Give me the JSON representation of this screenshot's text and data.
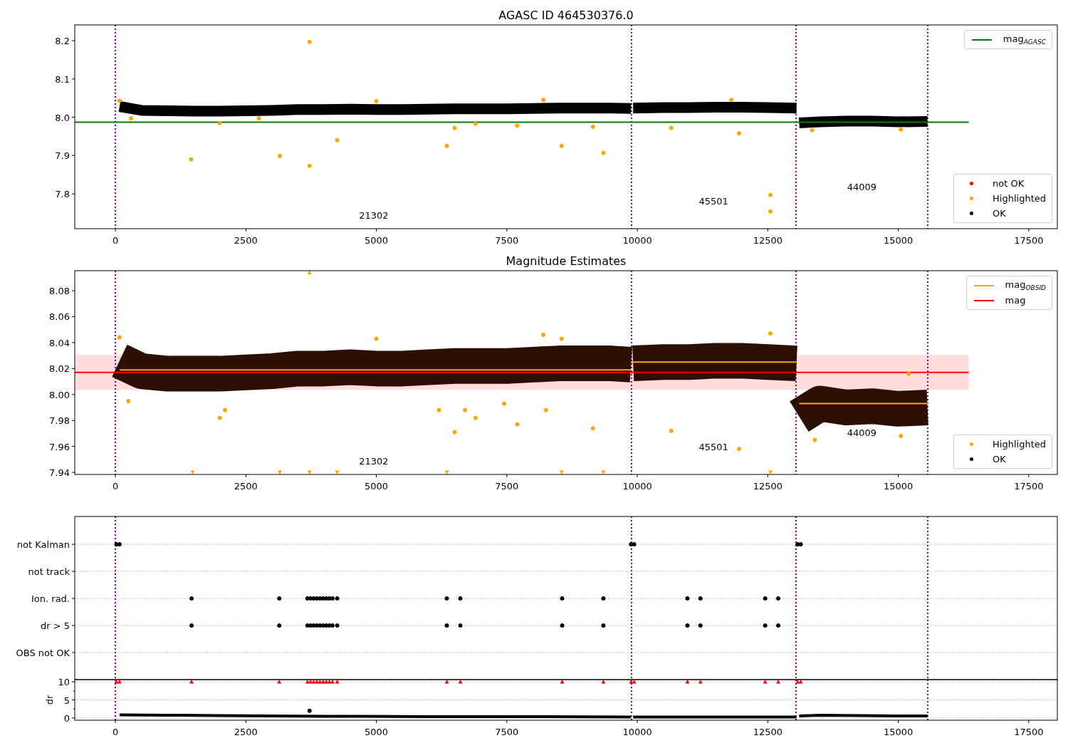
{
  "panels": [
    {
      "title": "AGASC ID 464530376.0",
      "charts": [
        {
          "chart_data": {
            "type": "scatter",
            "xlim": [
              -778,
              18047
            ],
            "ylim": [
              7.709,
              8.241
            ],
            "xticks": [
              0,
              2500,
              5000,
              7500,
              10000,
              12500,
              15000,
              17500
            ],
            "yticks": [
              {
                "value": 7.8,
                "label": "7.8"
              },
              {
                "value": 7.9,
                "label": "7.9"
              },
              {
                "value": 8.0,
                "label": "8.0"
              },
              {
                "value": 8.1,
                "label": "8.1"
              },
              {
                "value": 8.2,
                "label": "8.2"
              }
            ],
            "series": [
              {
                "type": "line",
                "marker": "none",
                "color": "#000000",
                "x": [
                  80,
                  500,
                  1000,
                  1500,
                  2000,
                  2500,
                  3000,
                  3500,
                  4000,
                  4500,
                  5000,
                  5500,
                  6000,
                  6500,
                  7000,
                  7500,
                  8000,
                  8500,
                  9000,
                  9500,
                  9880,
                  9900,
                  9920,
                  10500,
                  11000,
                  11500,
                  12000,
                  12500,
                  13050,
                  13075,
                  13100,
                  13500,
                  14000,
                  14500,
                  15000,
                  15560
                ],
                "values": [
                  8.028,
                  8.018,
                  8.017,
                  8.016,
                  8.016,
                  8.017,
                  8.018,
                  8.02,
                  8.02,
                  8.021,
                  8.02,
                  8.02,
                  8.021,
                  8.022,
                  8.022,
                  8.022,
                  8.023,
                  8.024,
                  8.024,
                  8.024,
                  8.023,
                  null,
                  8.024,
                  8.025,
                  8.025,
                  8.026,
                  8.026,
                  8.025,
                  8.024,
                  null,
                  7.985,
                  7.988,
                  7.99,
                  7.99,
                  7.988,
                  7.989
                ]
              },
              {
                "type": "scatter",
                "marker": "circle",
                "color": "#ffa500",
                "x": [
                  80,
                  300,
                  1450,
                  2000,
                  2750,
                  3150,
                  3720,
                  3720,
                  4250,
                  5000,
                  6350,
                  6500,
                  6900,
                  7700,
                  8200,
                  8550,
                  9150,
                  9350,
                  10650,
                  11800,
                  11950,
                  12550,
                  12550,
                  13350,
                  15050
                ],
                "values": [
                  8.043,
                  7.997,
                  7.89,
                  7.985,
                  7.997,
                  7.899,
                  7.873,
                  8.197,
                  7.94,
                  8.042,
                  7.925,
                  7.972,
                  7.983,
                  7.978,
                  8.045,
                  7.925,
                  7.975,
                  7.907,
                  7.972,
                  8.045,
                  7.958,
                  7.797,
                  7.754,
                  7.966,
                  7.968
                ]
              },
              {
                "type": "line",
                "marker": "none",
                "color": "#008000",
                "x": [
                  -778,
                  16350
                ],
                "values": [
                  7.987,
                  7.987
                ]
              }
            ],
            "ref_lines": [
              {
                "axis": "x",
                "value": 0,
                "color": "#800080"
              },
              {
                "axis": "x",
                "value": 9890,
                "color": "#800080"
              },
              {
                "axis": "x",
                "value": 13040,
                "color": "#800080"
              },
              {
                "axis": "x",
                "value": 15565,
                "color": "#800080"
              }
            ],
            "annotations": [
              "21302",
              "45501",
              "44009"
            ]
          },
          "legends": [
            {
              "entries": [
                {
                  "label": "mag$_{AGASC}$",
                  "kind": "line",
                  "color": "#008000"
                }
              ]
            },
            {
              "entries": [
                {
                  "label": "not OK",
                  "kind": "dot",
                  "color": "#ff0000"
                },
                {
                  "label": "Highlighted",
                  "kind": "dot",
                  "color": "#ffa500"
                },
                {
                  "label": "OK",
                  "kind": "dot",
                  "color": "#000000"
                }
              ]
            }
          ]
        }
      ]
    },
    {
      "title": "Magnitude Estimates",
      "charts": [
        {
          "chart_data": {
            "type": "scatter",
            "xlim": [
              -778,
              18047
            ],
            "ylim": [
              7.9384,
              8.0954
            ],
            "xticks": [
              0,
              2500,
              5000,
              7500,
              10000,
              12500,
              15000,
              17500
            ],
            "yticks": [
              {
                "value": 7.94,
                "label": "7.94"
              },
              {
                "value": 7.96,
                "label": "7.96"
              },
              {
                "value": 7.98,
                "label": "7.98"
              },
              {
                "value": 8.0,
                "label": "8.00"
              },
              {
                "value": 8.02,
                "label": "8.02"
              },
              {
                "value": 8.04,
                "label": "8.04"
              },
              {
                "value": 8.06,
                "label": "8.06"
              },
              {
                "value": 8.08,
                "label": "8.08"
              }
            ],
            "series": [
              {
                "type": "line",
                "marker": "none",
                "color": "#2b1000",
                "x": [
                  80,
                  500,
                  1000,
                  1500,
                  2000,
                  2500,
                  3000,
                  3500,
                  4000,
                  4500,
                  5000,
                  5500,
                  6000,
                  6500,
                  7000,
                  7500,
                  8000,
                  8500,
                  9000,
                  9500,
                  9880,
                  9900,
                  9920,
                  10500,
                  11000,
                  11500,
                  12000,
                  12500,
                  13050,
                  13075,
                  13100,
                  13500,
                  14000,
                  14500,
                  15000,
                  15560
                ],
                "values": [
                  8.026,
                  8.018,
                  8.016,
                  8.016,
                  8.016,
                  8.017,
                  8.018,
                  8.02,
                  8.02,
                  8.021,
                  8.02,
                  8.02,
                  8.021,
                  8.022,
                  8.022,
                  8.022,
                  8.023,
                  8.024,
                  8.024,
                  8.024,
                  8.023,
                  null,
                  8.024,
                  8.025,
                  8.025,
                  8.026,
                  8.026,
                  8.025,
                  8.024,
                  null,
                  7.983,
                  7.993,
                  7.99,
                  7.991,
                  7.989,
                  7.99
                ]
              },
              {
                "type": "scatter",
                "marker": "circle",
                "color": "#ffa500",
                "x": [
                  80,
                  250,
                  2000,
                  2100,
                  5000,
                  6200,
                  6500,
                  6700,
                  6900,
                  7450,
                  7700,
                  8200,
                  8250,
                  8550,
                  9150,
                  10650,
                  11950,
                  12550,
                  13400,
                  15050,
                  15200
                ],
                "values": [
                  8.044,
                  7.995,
                  7.982,
                  7.988,
                  8.043,
                  7.988,
                  7.971,
                  7.988,
                  7.982,
                  7.993,
                  7.977,
                  8.046,
                  7.988,
                  8.043,
                  7.974,
                  7.972,
                  7.958,
                  8.047,
                  7.965,
                  7.968,
                  8.016
                ]
              },
              {
                "type": "scatter",
                "marker": "triangle",
                "color": "#ffa500",
                "x": [
                  1480,
                  3150,
                  3720,
                  4250,
                  6350,
                  8550,
                  9350,
                  12550
                ],
                "values": [
                  7.94,
                  7.94,
                  7.94,
                  7.94,
                  7.94,
                  7.94,
                  7.94,
                  7.94
                ]
              },
              {
                "type": "scatter",
                "marker": "triangle",
                "color": "#ffa500",
                "x": [
                  3720
                ],
                "values": [
                  8.094
                ]
              },
              {
                "type": "line",
                "marker": "none",
                "color": "#ff0000",
                "x": [
                  -778,
                  16350
                ],
                "values": [
                  8.017,
                  8.017
                ]
              },
              {
                "type": "line",
                "marker": "none",
                "color": "#ffa500",
                "x": [
                  80,
                  9880,
                  null,
                  9900,
                  13050,
                  null,
                  13100,
                  15580
                ],
                "values": [
                  8.019,
                  8.019,
                  null,
                  8.025,
                  8.025,
                  null,
                  7.993,
                  7.993
                ]
              }
            ],
            "bands": [
              {
                "axis": "y",
                "from": 8.0035,
                "to": 8.0305,
                "color": "#ffdddd"
              }
            ],
            "ref_lines": [
              {
                "axis": "x",
                "value": 0,
                "color": "#800080"
              },
              {
                "axis": "x",
                "value": 9890,
                "color": "#800080"
              },
              {
                "axis": "x",
                "value": 13040,
                "color": "#800080"
              },
              {
                "axis": "x",
                "value": 15565,
                "color": "#800080"
              }
            ],
            "annotations": [
              "21302",
              "45501",
              "44009"
            ]
          },
          "legends": [
            {
              "entries": [
                {
                  "label": "mag$_{OBSID}$",
                  "kind": "line",
                  "color": "#ffa500"
                },
                {
                  "label": "mag",
                  "kind": "line",
                  "color": "#ff0000"
                }
              ]
            },
            {
              "entries": [
                {
                  "label": "Highlighted",
                  "kind": "dot",
                  "color": "#ffa500"
                },
                {
                  "label": "OK",
                  "kind": "dot",
                  "color": "#000000"
                }
              ]
            }
          ]
        }
      ]
    },
    {
      "charts": [
        {
          "chart_data": {
            "type": "scatter",
            "orientation": "horizontal",
            "grid": true,
            "xlim": [
              -778,
              18047
            ],
            "categories": [
              "not Kalman",
              "not track",
              "Ion. rad.",
              "dr > 5",
              "OBS not OK"
            ],
            "series": [
              {
                "type": "scatter",
                "marker": "circle",
                "color": "#000000",
                "values": [
                  20,
                  null,
                  null,
                  null,
                  null
                ]
              },
              {
                "type": "scatter",
                "marker": "circle",
                "color": "#000000",
                "values": [
                  80,
                  null,
                  null,
                  null,
                  null
                ]
              },
              {
                "type": "scatter",
                "marker": "circle",
                "color": "#000000",
                "values": [
                  9880,
                  null,
                  null,
                  null,
                  null
                ]
              },
              {
                "type": "scatter",
                "marker": "circle",
                "color": "#000000",
                "values": [
                  9940,
                  null,
                  null,
                  null,
                  null
                ]
              },
              {
                "type": "scatter",
                "marker": "circle",
                "color": "#000000",
                "values": [
                  13070,
                  null,
                  null,
                  null,
                  null
                ]
              },
              {
                "type": "scatter",
                "marker": "circle",
                "color": "#000000",
                "values": [
                  13130,
                  null,
                  null,
                  null,
                  null
                ]
              },
              {
                "type": "scatter",
                "marker": "circle",
                "color": "#000000",
                "values": [
                  null,
                  null,
                  1460,
                  1460,
                  null
                ]
              },
              {
                "type": "scatter",
                "marker": "circle",
                "color": "#000000",
                "values": [
                  null,
                  null,
                  3140,
                  3140,
                  null
                ]
              },
              {
                "type": "scatter",
                "marker": "circle",
                "color": "#000000",
                "values": [
                  null,
                  null,
                  3680,
                  3680,
                  null
                ]
              },
              {
                "type": "scatter",
                "marker": "circle",
                "color": "#000000",
                "values": [
                  null,
                  null,
                  3740,
                  3740,
                  null
                ]
              },
              {
                "type": "scatter",
                "marker": "circle",
                "color": "#000000",
                "values": [
                  null,
                  null,
                  3800,
                  3800,
                  null
                ]
              },
              {
                "type": "scatter",
                "marker": "circle",
                "color": "#000000",
                "values": [
                  null,
                  null,
                  3860,
                  3860,
                  null
                ]
              },
              {
                "type": "scatter",
                "marker": "circle",
                "color": "#000000",
                "values": [
                  null,
                  null,
                  3920,
                  3920,
                  null
                ]
              },
              {
                "type": "scatter",
                "marker": "circle",
                "color": "#000000",
                "values": [
                  null,
                  null,
                  3980,
                  3980,
                  null
                ]
              },
              {
                "type": "scatter",
                "marker": "circle",
                "color": "#000000",
                "values": [
                  null,
                  null,
                  4040,
                  4040,
                  null
                ]
              },
              {
                "type": "scatter",
                "marker": "circle",
                "color": "#000000",
                "values": [
                  null,
                  null,
                  4100,
                  4100,
                  null
                ]
              },
              {
                "type": "scatter",
                "marker": "circle",
                "color": "#000000",
                "values": [
                  null,
                  null,
                  4160,
                  4160,
                  null
                ]
              },
              {
                "type": "scatter",
                "marker": "circle",
                "color": "#000000",
                "values": [
                  null,
                  null,
                  4250,
                  4250,
                  null
                ]
              },
              {
                "type": "scatter",
                "marker": "circle",
                "color": "#000000",
                "values": [
                  null,
                  null,
                  6350,
                  6350,
                  null
                ]
              },
              {
                "type": "scatter",
                "marker": "circle",
                "color": "#000000",
                "values": [
                  null,
                  null,
                  6610,
                  6610,
                  null
                ]
              },
              {
                "type": "scatter",
                "marker": "circle",
                "color": "#000000",
                "values": [
                  null,
                  null,
                  8560,
                  8560,
                  null
                ]
              },
              {
                "type": "scatter",
                "marker": "circle",
                "color": "#000000",
                "values": [
                  null,
                  null,
                  9350,
                  9350,
                  null
                ]
              },
              {
                "type": "scatter",
                "marker": "circle",
                "color": "#000000",
                "values": [
                  null,
                  null,
                  10960,
                  10960,
                  null
                ]
              },
              {
                "type": "scatter",
                "marker": "circle",
                "color": "#000000",
                "values": [
                  null,
                  null,
                  11210,
                  11210,
                  null
                ]
              },
              {
                "type": "scatter",
                "marker": "circle",
                "color": "#000000",
                "values": [
                  null,
                  null,
                  12450,
                  12450,
                  null
                ]
              },
              {
                "type": "scatter",
                "marker": "circle",
                "color": "#000000",
                "values": [
                  null,
                  null,
                  12700,
                  12700,
                  null
                ]
              }
            ],
            "ref_lines": [
              {
                "axis": "x",
                "value": 0,
                "color": "#800080"
              },
              {
                "axis": "x",
                "value": 9890,
                "color": "#800080"
              },
              {
                "axis": "x",
                "value": 13040,
                "color": "#800080"
              },
              {
                "axis": "x",
                "value": 15565,
                "color": "#800080"
              }
            ]
          }
        },
        {
          "chart_data": {
            "type": "scatter",
            "grid": true,
            "ylabel": "dr",
            "xlim": [
              -778,
              18047
            ],
            "ylim": [
              -0.6,
              10.6
            ],
            "xticks": [
              0,
              2500,
              5000,
              7500,
              10000,
              12500,
              15000,
              17500
            ],
            "yticks": [
              0,
              5,
              10
            ],
            "series": [
              {
                "type": "line",
                "marker": "none",
                "color": "#000000",
                "x": [
                  80,
                  1000,
                  2000,
                  3000,
                  4000,
                  6000,
                  8000,
                  9880,
                  9900,
                  9920,
                  12000,
                  13050,
                  13075,
                  13100,
                  13500,
                  15000,
                  15560
                ],
                "values": [
                  0.9,
                  0.8,
                  0.7,
                  0.6,
                  0.5,
                  0.4,
                  0.4,
                  0.3,
                  null,
                  0.3,
                  0.3,
                  0.3,
                  null,
                  0.6,
                  0.8,
                  0.6,
                  0.6
                ]
              },
              {
                "type": "scatter",
                "marker": "circle",
                "color": "#000000",
                "x": [
                  3720
                ],
                "values": [
                  2
                ]
              },
              {
                "type": "scatter",
                "marker": "triangle",
                "color": "#ff0000",
                "x": [
                  20,
                  80,
                  1460,
                  3140,
                  3680,
                  3740,
                  3800,
                  3860,
                  3920,
                  3980,
                  4040,
                  4100,
                  4160,
                  4250,
                  6350,
                  6610,
                  8560,
                  9350,
                  9880,
                  9940,
                  10960,
                  11210,
                  12450,
                  12700,
                  13070,
                  13130
                ],
                "values": [
                  10,
                  10,
                  10,
                  10,
                  10,
                  10,
                  10,
                  10,
                  10,
                  10,
                  10,
                  10,
                  10,
                  10,
                  10,
                  10,
                  10,
                  10,
                  10,
                  10,
                  10,
                  10,
                  10,
                  10,
                  10,
                  10
                ]
              }
            ],
            "ref_lines": [
              {
                "axis": "x",
                "value": 0,
                "color": "#800080"
              },
              {
                "axis": "x",
                "value": 9890,
                "color": "#800080"
              },
              {
                "axis": "x",
                "value": 13040,
                "color": "#800080"
              },
              {
                "axis": "x",
                "value": 15565,
                "color": "#800080"
              }
            ]
          }
        }
      ]
    }
  ]
}
